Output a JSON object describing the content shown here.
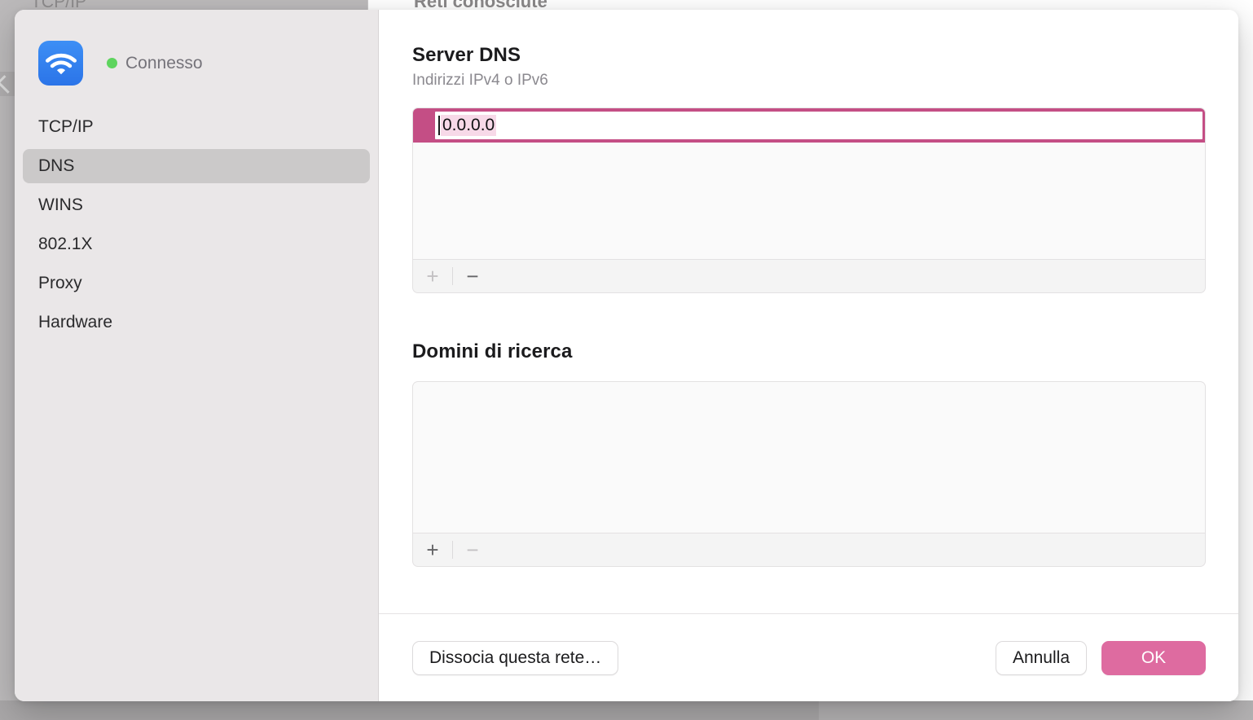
{
  "background": {
    "left_panel_label": "TCP/IP",
    "right_panel_heading": "Reti conosciute"
  },
  "sidebar": {
    "wifi_icon": "wifi-icon",
    "status": "Connesso",
    "items": [
      {
        "label": "TCP/IP",
        "selected": false
      },
      {
        "label": "DNS",
        "selected": true
      },
      {
        "label": "WINS",
        "selected": false
      },
      {
        "label": "802.1X",
        "selected": false
      },
      {
        "label": "Proxy",
        "selected": false
      },
      {
        "label": "Hardware",
        "selected": false
      }
    ]
  },
  "dns_section": {
    "title": "Server DNS",
    "subtitle": "Indirizzi IPv4 o IPv6",
    "editing_value": "0.0.0.0",
    "add_label": "+",
    "remove_label": "−",
    "add_enabled": false,
    "remove_enabled": true
  },
  "search_domains_section": {
    "title": "Domini di ricerca",
    "entries": [],
    "add_label": "+",
    "remove_label": "−",
    "add_enabled": true,
    "remove_enabled": false
  },
  "footer": {
    "forget_label": "Dissocia questa rete…",
    "cancel_label": "Annulla",
    "ok_label": "OK"
  },
  "colors": {
    "accent": "#de6ba0",
    "focus_ring": "#c44e85",
    "selection": "#f7d9e8",
    "status_dot": "#5ed45e",
    "sidebar_bg": "#eae7e8",
    "nav_selected": "#cbc9c9"
  }
}
